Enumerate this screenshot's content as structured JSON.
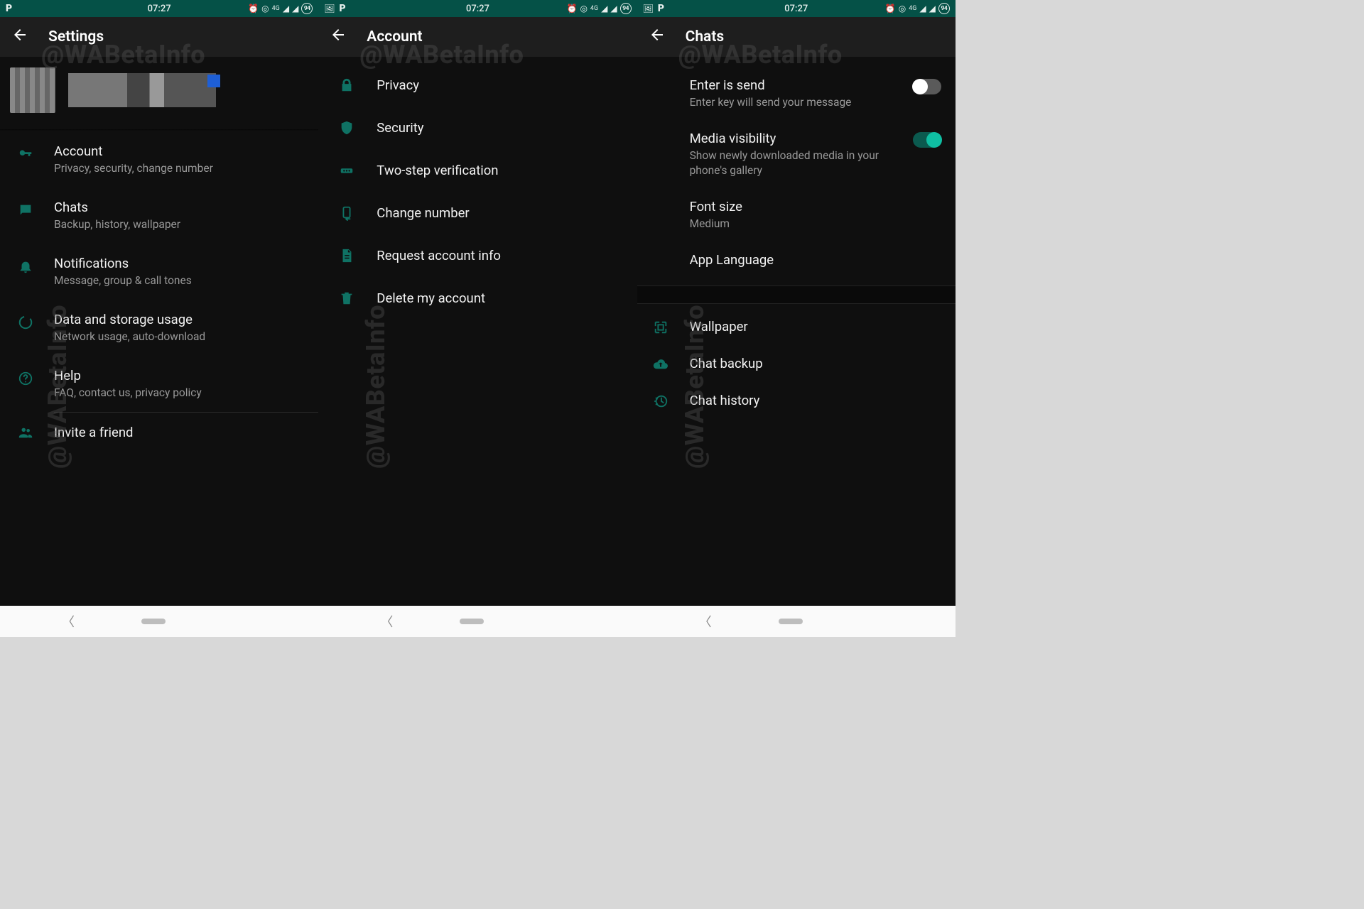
{
  "status": {
    "time": "07:27",
    "battery_badge": "94",
    "network_label": "4G"
  },
  "watermark": "@WABetaInfo",
  "panel1": {
    "title": "Settings",
    "items": [
      {
        "title": "Account",
        "sub": "Privacy, security, change number"
      },
      {
        "title": "Chats",
        "sub": "Backup, history, wallpaper"
      },
      {
        "title": "Notifications",
        "sub": "Message, group & call tones"
      },
      {
        "title": "Data and storage usage",
        "sub": "Network usage, auto-download"
      },
      {
        "title": "Help",
        "sub": "FAQ, contact us, privacy policy"
      }
    ],
    "invite": "Invite a friend"
  },
  "panel2": {
    "title": "Account",
    "items": [
      "Privacy",
      "Security",
      "Two-step verification",
      "Change number",
      "Request account info",
      "Delete my account"
    ]
  },
  "panel3": {
    "title": "Chats",
    "enter_send": {
      "title": "Enter is send",
      "sub": "Enter key will send your message",
      "on": false
    },
    "media_vis": {
      "title": "Media visibility",
      "sub": "Show newly downloaded media in your phone's gallery",
      "on": true
    },
    "font_size": {
      "title": "Font size",
      "sub": "Medium"
    },
    "app_lang": {
      "title": "App Language"
    },
    "wallpaper": "Wallpaper",
    "backup": "Chat backup",
    "history": "Chat history"
  }
}
